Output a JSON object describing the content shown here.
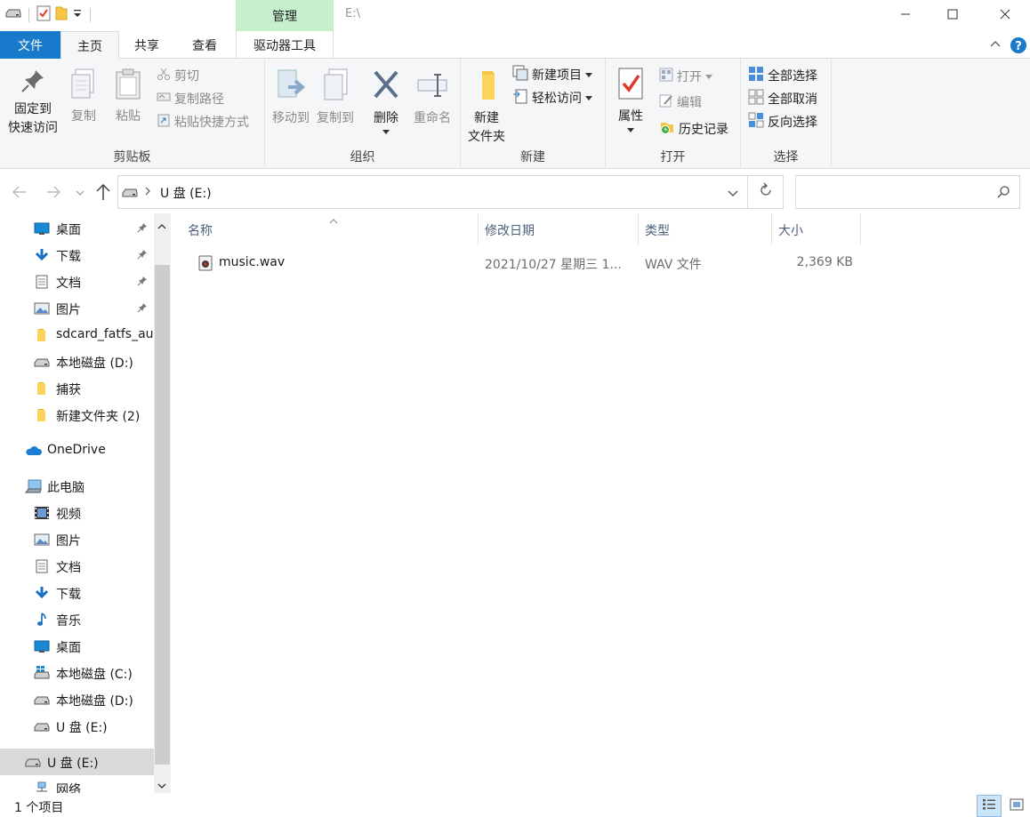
{
  "window": {
    "title": "E:\\",
    "context_tab": "管理",
    "controls": {
      "minimize": "—",
      "maximize": "☐",
      "close": "✕"
    }
  },
  "tabs": {
    "file": "文件",
    "home": "主页",
    "share": "共享",
    "view": "查看",
    "drive_tools": "驱动器工具"
  },
  "ribbon": {
    "clipboard": {
      "label": "剪贴板",
      "pin_line1": "固定到",
      "pin_line2": "快速访问",
      "copy": "复制",
      "paste": "粘贴",
      "cut": "剪切",
      "copy_path": "复制路径",
      "paste_shortcut": "粘贴快捷方式"
    },
    "organize": {
      "label": "组织",
      "move_to": "移动到",
      "copy_to": "复制到",
      "delete": "删除",
      "rename": "重命名"
    },
    "new": {
      "label": "新建",
      "new_folder_line1": "新建",
      "new_folder_line2": "文件夹",
      "new_item": "新建项目",
      "easy_access": "轻松访问"
    },
    "open": {
      "label": "打开",
      "properties": "属性",
      "open": "打开",
      "edit": "编辑",
      "history": "历史记录"
    },
    "select": {
      "label": "选择",
      "select_all": "全部选择",
      "select_none": "全部取消",
      "invert": "反向选择"
    }
  },
  "address": {
    "path": "U 盘 (E:)",
    "search_placeholder": ""
  },
  "nav": {
    "items": [
      {
        "label": "桌面",
        "icon": "desktop-icon",
        "pinned": true
      },
      {
        "label": "下载",
        "icon": "download-icon",
        "pinned": true
      },
      {
        "label": "文档",
        "icon": "document-icon",
        "pinned": true
      },
      {
        "label": "图片",
        "icon": "picture-icon",
        "pinned": true
      },
      {
        "label": "sdcard_fatfs_au",
        "icon": "folder-icon",
        "pinned": false
      },
      {
        "label": "本地磁盘 (D:)",
        "icon": "drive-icon",
        "pinned": false
      },
      {
        "label": "捕获",
        "icon": "folder-icon",
        "pinned": false
      },
      {
        "label": "新建文件夹 (2)",
        "icon": "folder-icon",
        "pinned": false
      },
      {
        "label": "OneDrive",
        "icon": "cloud-icon",
        "pinned": false
      },
      {
        "label": "此电脑",
        "icon": "computer-icon",
        "pinned": false
      },
      {
        "label": "视频",
        "icon": "video-icon",
        "pinned": false
      },
      {
        "label": "图片",
        "icon": "picture-icon",
        "pinned": false
      },
      {
        "label": "文档",
        "icon": "document-icon",
        "pinned": false
      },
      {
        "label": "下载",
        "icon": "download-icon",
        "pinned": false
      },
      {
        "label": "音乐",
        "icon": "music-icon",
        "pinned": false
      },
      {
        "label": "桌面",
        "icon": "desktop-icon",
        "pinned": false
      },
      {
        "label": "本地磁盘 (C:)",
        "icon": "windows-drive-icon",
        "pinned": false
      },
      {
        "label": "本地磁盘 (D:)",
        "icon": "drive-icon",
        "pinned": false
      },
      {
        "label": "U 盘 (E:)",
        "icon": "usb-drive-icon",
        "pinned": false
      },
      {
        "label": "U 盘 (E:)",
        "icon": "usb-drive-icon",
        "pinned": false,
        "selected": true
      },
      {
        "label": "网络",
        "icon": "network-icon",
        "pinned": false
      }
    ]
  },
  "files": {
    "columns": {
      "name": "名称",
      "date": "修改日期",
      "type": "类型",
      "size": "大小"
    },
    "rows": [
      {
        "name": "music.wav",
        "date": "2021/10/27 星期三 1...",
        "type": "WAV 文件",
        "size": "2,369 KB"
      }
    ]
  },
  "status": {
    "count": "1 个项目"
  },
  "colors": {
    "file_tab": "#1979ca",
    "context_tab": "#c6efce",
    "ribbon_bg": "#f5f6f7",
    "nav_selected": "#d9d9d9"
  }
}
